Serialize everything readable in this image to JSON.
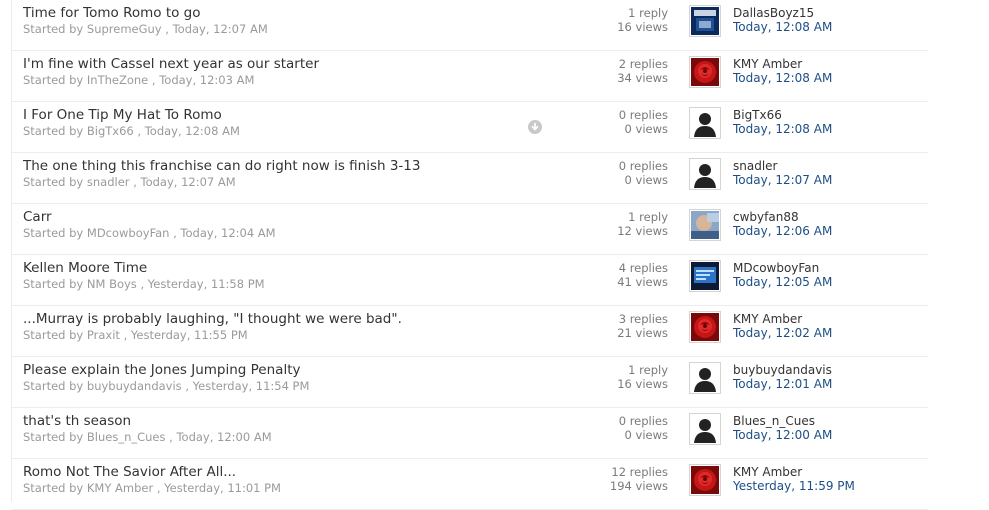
{
  "topics": [
    {
      "title": "Time for Tomo Romo to go",
      "started_prefix": "Started by",
      "starter": "SupremeGuy",
      "started_time": ", Today, 12:07 AM",
      "replies": "1 reply",
      "views": "16 views",
      "last_poster": "DallasBoyz15",
      "last_time": "Today, 12:08 AM",
      "avatar": "team-logo-avatar",
      "unread_icon": false
    },
    {
      "title": "I'm fine with Cassel next year as our starter",
      "started_prefix": "Started by",
      "starter": "InTheZone",
      "started_time": ", Today, 12:03 AM",
      "replies": "2 replies",
      "views": "34 views",
      "last_poster": "KMY Amber",
      "last_time": "Today, 12:08 AM",
      "avatar": "red-rose-avatar",
      "unread_icon": false
    },
    {
      "title": "I For One Tip My Hat To Romo",
      "started_prefix": "Started by",
      "starter": "BigTx66",
      "started_time": ", Today, 12:08 AM",
      "replies": "0 replies",
      "views": "0 views",
      "last_poster": "BigTx66",
      "last_time": "Today, 12:08 AM",
      "avatar": "default-avatar",
      "unread_icon": true
    },
    {
      "title": "The one thing this franchise can do right now is finish 3-13",
      "started_prefix": "Started by",
      "starter": "snadler",
      "started_time": ", Today, 12:07 AM",
      "replies": "0 replies",
      "views": "0 views",
      "last_poster": "snadler",
      "last_time": "Today, 12:07 AM",
      "avatar": "default-avatar",
      "unread_icon": false
    },
    {
      "title": "Carr",
      "started_prefix": "Started by",
      "starter": "MDcowboyFan",
      "started_time": ", Today, 12:04 AM",
      "replies": "1 reply",
      "views": "12 views",
      "last_poster": "cwbyfan88",
      "last_time": "Today, 12:06 AM",
      "avatar": "photo-avatar",
      "unread_icon": false
    },
    {
      "title": "Kellen Moore Time",
      "started_prefix": "Started by",
      "starter": "NM Boys",
      "started_time": ", Yesterday, 11:58 PM",
      "replies": "4 replies",
      "views": "41 views",
      "last_poster": "MDcowboyFan",
      "last_time": "Today, 12:05 AM",
      "avatar": "screen-avatar",
      "unread_icon": false
    },
    {
      "title": "...Murray is probably laughing, \"I thought we were bad\".",
      "started_prefix": "Started by",
      "starter": "Praxit",
      "started_time": ", Yesterday, 11:55 PM",
      "replies": "3 replies",
      "views": "21 views",
      "last_poster": "KMY Amber",
      "last_time": "Today, 12:02 AM",
      "avatar": "red-rose-avatar",
      "unread_icon": false
    },
    {
      "title": "Please explain the Jones Jumping Penalty",
      "started_prefix": "Started by",
      "starter": "buybuydandavis",
      "started_time": ", Yesterday, 11:54 PM",
      "replies": "1 reply",
      "views": "16 views",
      "last_poster": "buybuydandavis",
      "last_time": "Today, 12:01 AM",
      "avatar": "default-avatar",
      "unread_icon": false
    },
    {
      "title": "that's th season",
      "started_prefix": "Started by",
      "starter": "Blues_n_Cues",
      "started_time": ", Today, 12:00 AM",
      "replies": "0 replies",
      "views": "0 views",
      "last_poster": "Blues_n_Cues",
      "last_time": "Today, 12:00 AM",
      "avatar": "default-avatar",
      "unread_icon": false
    },
    {
      "title": "Romo Not The Savior After All...",
      "started_prefix": "Started by",
      "starter": "KMY Amber",
      "started_time": ", Yesterday, 11:01 PM",
      "replies": "12 replies",
      "views": "194 views",
      "last_poster": "KMY Amber",
      "last_time": "Yesterday, 11:59 PM",
      "avatar": "red-rose-avatar",
      "unread_icon": false
    }
  ],
  "colors": {
    "link_blue": "#1d4f86",
    "title_text": "#333333",
    "meta_text": "#9a9a9a",
    "divider": "#ececec"
  }
}
